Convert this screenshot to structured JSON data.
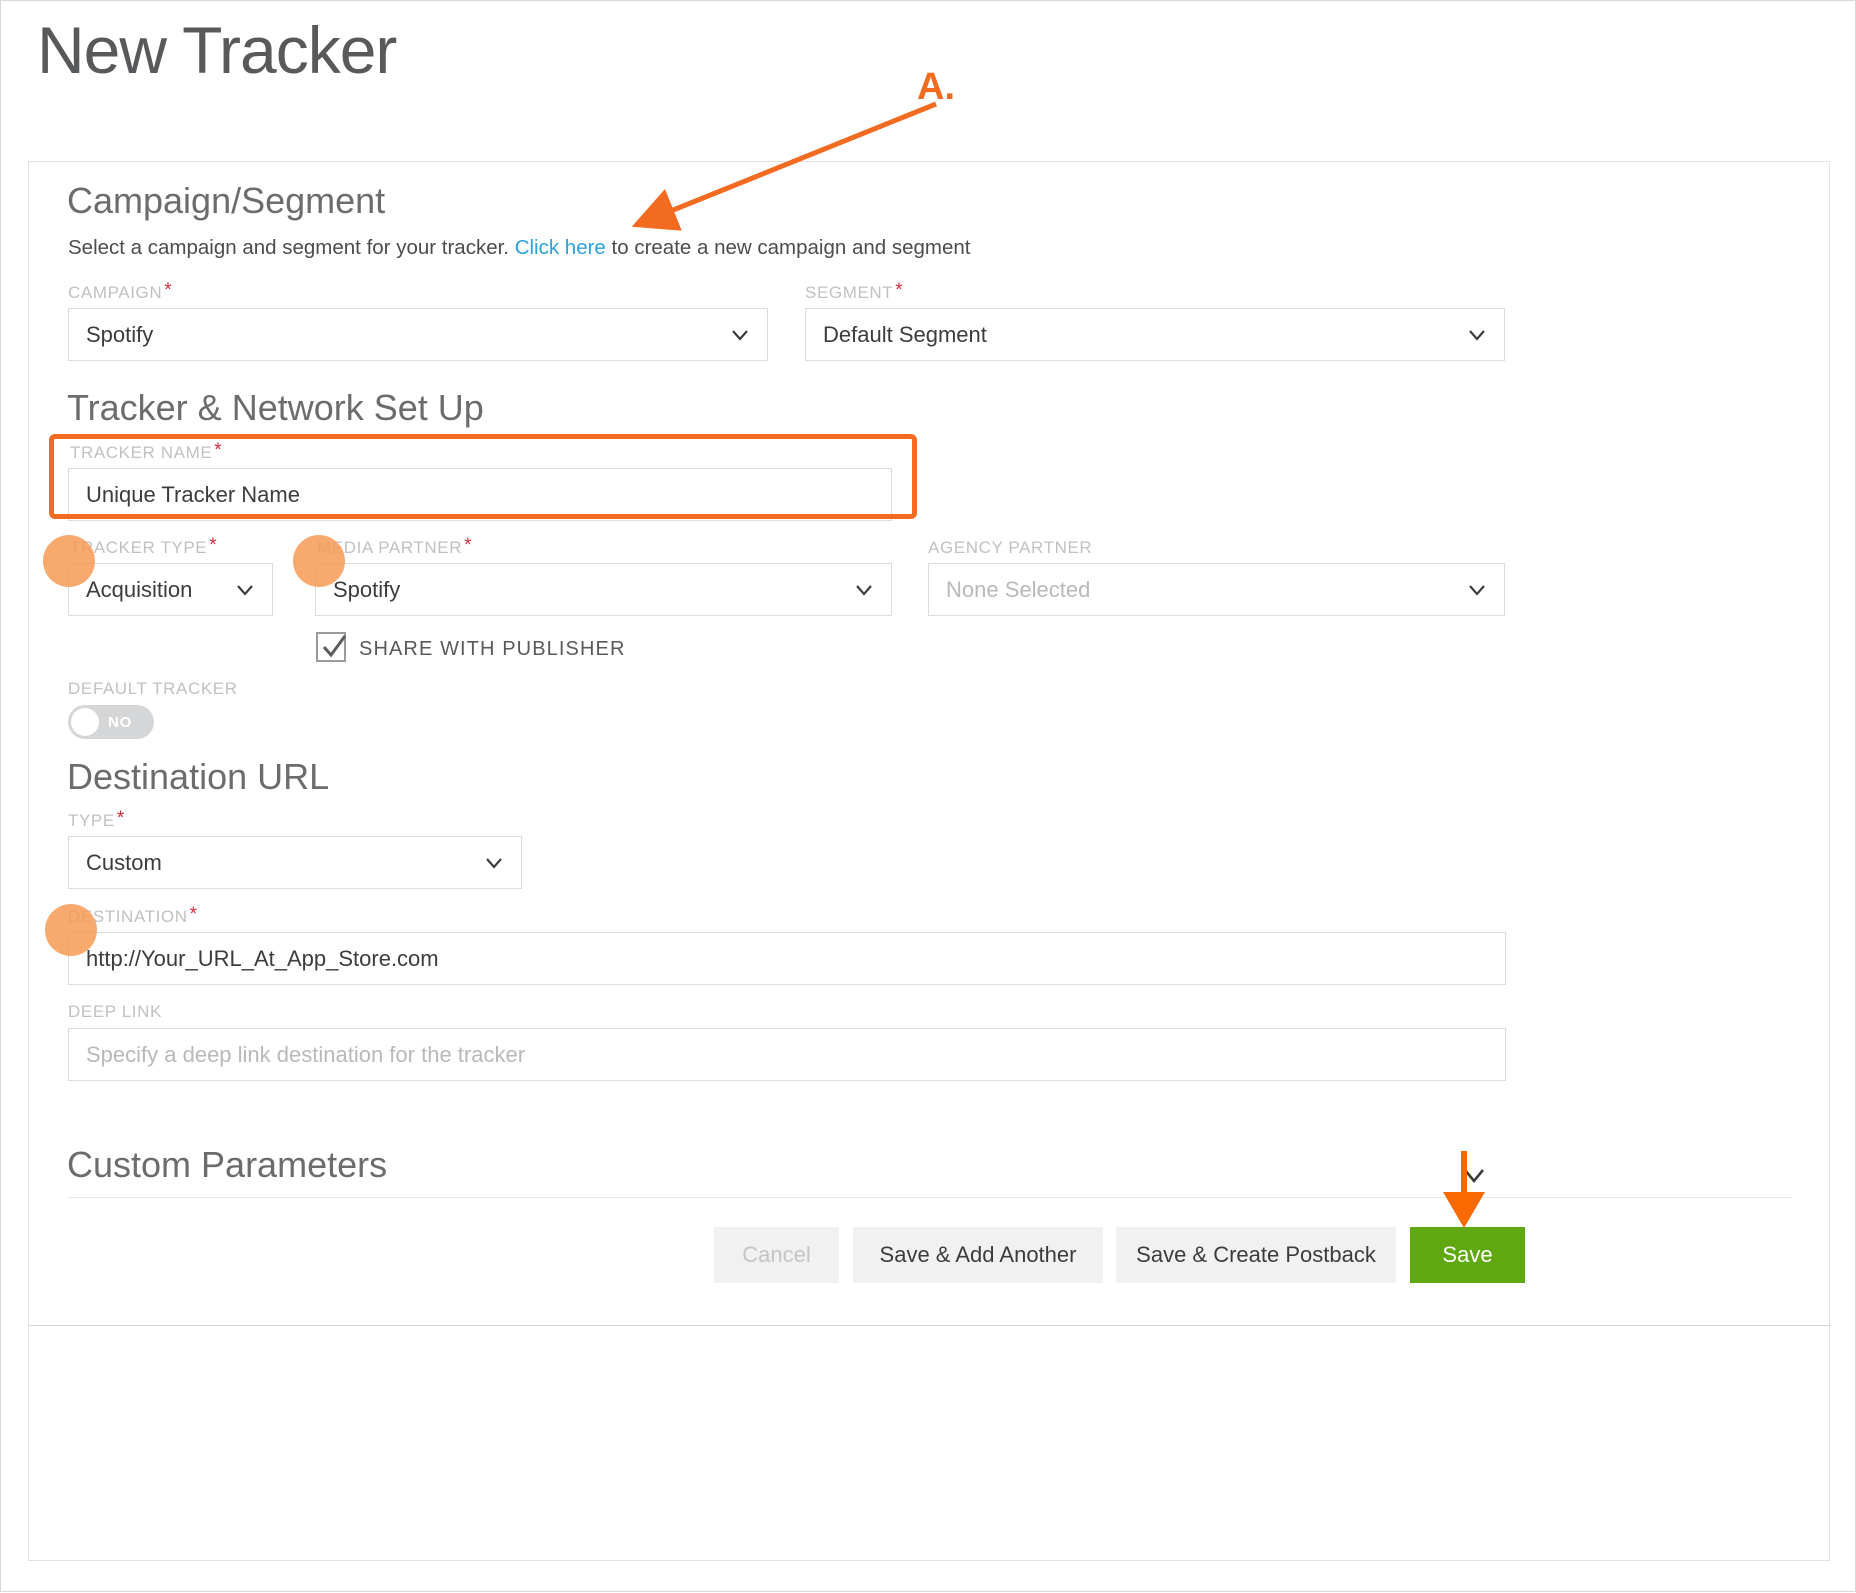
{
  "page": {
    "title": "New Tracker"
  },
  "annotations": {
    "label_a": "A.",
    "arrow_to_click_here": "arrow-icon",
    "arrow_to_save": "arrow-down-icon",
    "highlight_tracker_name": "highlight-box",
    "dots": [
      "tracker-type-dot",
      "media-partner-dot",
      "destination-dot"
    ]
  },
  "campaign_segment": {
    "heading": "Campaign/Segment",
    "description_before": "Select a campaign and segment for your tracker.",
    "description_link": "Click here",
    "description_after": "to create a new campaign and segment",
    "campaign": {
      "label": "CAMPAIGN",
      "required": "*",
      "value": "Spotify"
    },
    "segment": {
      "label": "SEGMENT",
      "required": "*",
      "value": "Default Segment"
    }
  },
  "tracker_network": {
    "heading": "Tracker & Network Set Up",
    "tracker_name": {
      "label": "TRACKER NAME",
      "required": "*",
      "value": "Unique Tracker Name"
    },
    "tracker_type": {
      "label": "TRACKER TYPE",
      "required": "*",
      "value": "Acquisition"
    },
    "media_partner": {
      "label": "MEDIA PARTNER",
      "required": "*",
      "value": "Spotify"
    },
    "agency_partner": {
      "label": "AGENCY PARTNER",
      "required": "",
      "value": "None Selected"
    },
    "share_with_publisher": {
      "label": "SHARE WITH PUBLISHER",
      "checked": true
    },
    "default_tracker": {
      "label": "DEFAULT TRACKER",
      "state": "NO"
    }
  },
  "destination_url": {
    "heading": "Destination URL",
    "type": {
      "label": "TYPE",
      "required": "*",
      "value": "Custom"
    },
    "destination": {
      "label": "DESTINATION",
      "required": "*",
      "value": "http://Your_URL_At_App_Store.com"
    },
    "deep_link": {
      "label": "DEEP LINK",
      "required": "",
      "placeholder": "Specify a deep link destination for the tracker"
    }
  },
  "custom_parameters": {
    "heading": "Custom Parameters",
    "expand_icon": "chevron-down-icon"
  },
  "footer": {
    "cancel": "Cancel",
    "save_add_another": "Save & Add Another",
    "save_create_postback": "Save & Create Postback",
    "save": "Save"
  },
  "colors": {
    "accent_orange": "#f26b21",
    "dot_orange": "#f79b55",
    "link_blue": "#29a3e0",
    "save_green": "#5fa80f",
    "required_red": "#cf2e3f",
    "label_grey": "#bfc1c3"
  }
}
